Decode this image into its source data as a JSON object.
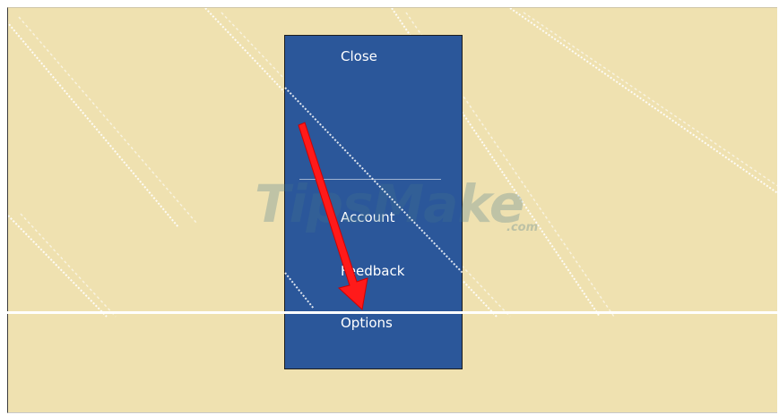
{
  "menu": {
    "close_label": "Close",
    "account_label": "Account",
    "feedback_label": "Feedback",
    "options_label": "Options"
  },
  "watermark": {
    "text": "TipsMake",
    "suffix": ".com"
  },
  "colors": {
    "background": "#efe1b0",
    "menu": "#2b579a",
    "arrow": "#ff1a1a"
  },
  "icons": {
    "annotation": "red-arrow"
  }
}
